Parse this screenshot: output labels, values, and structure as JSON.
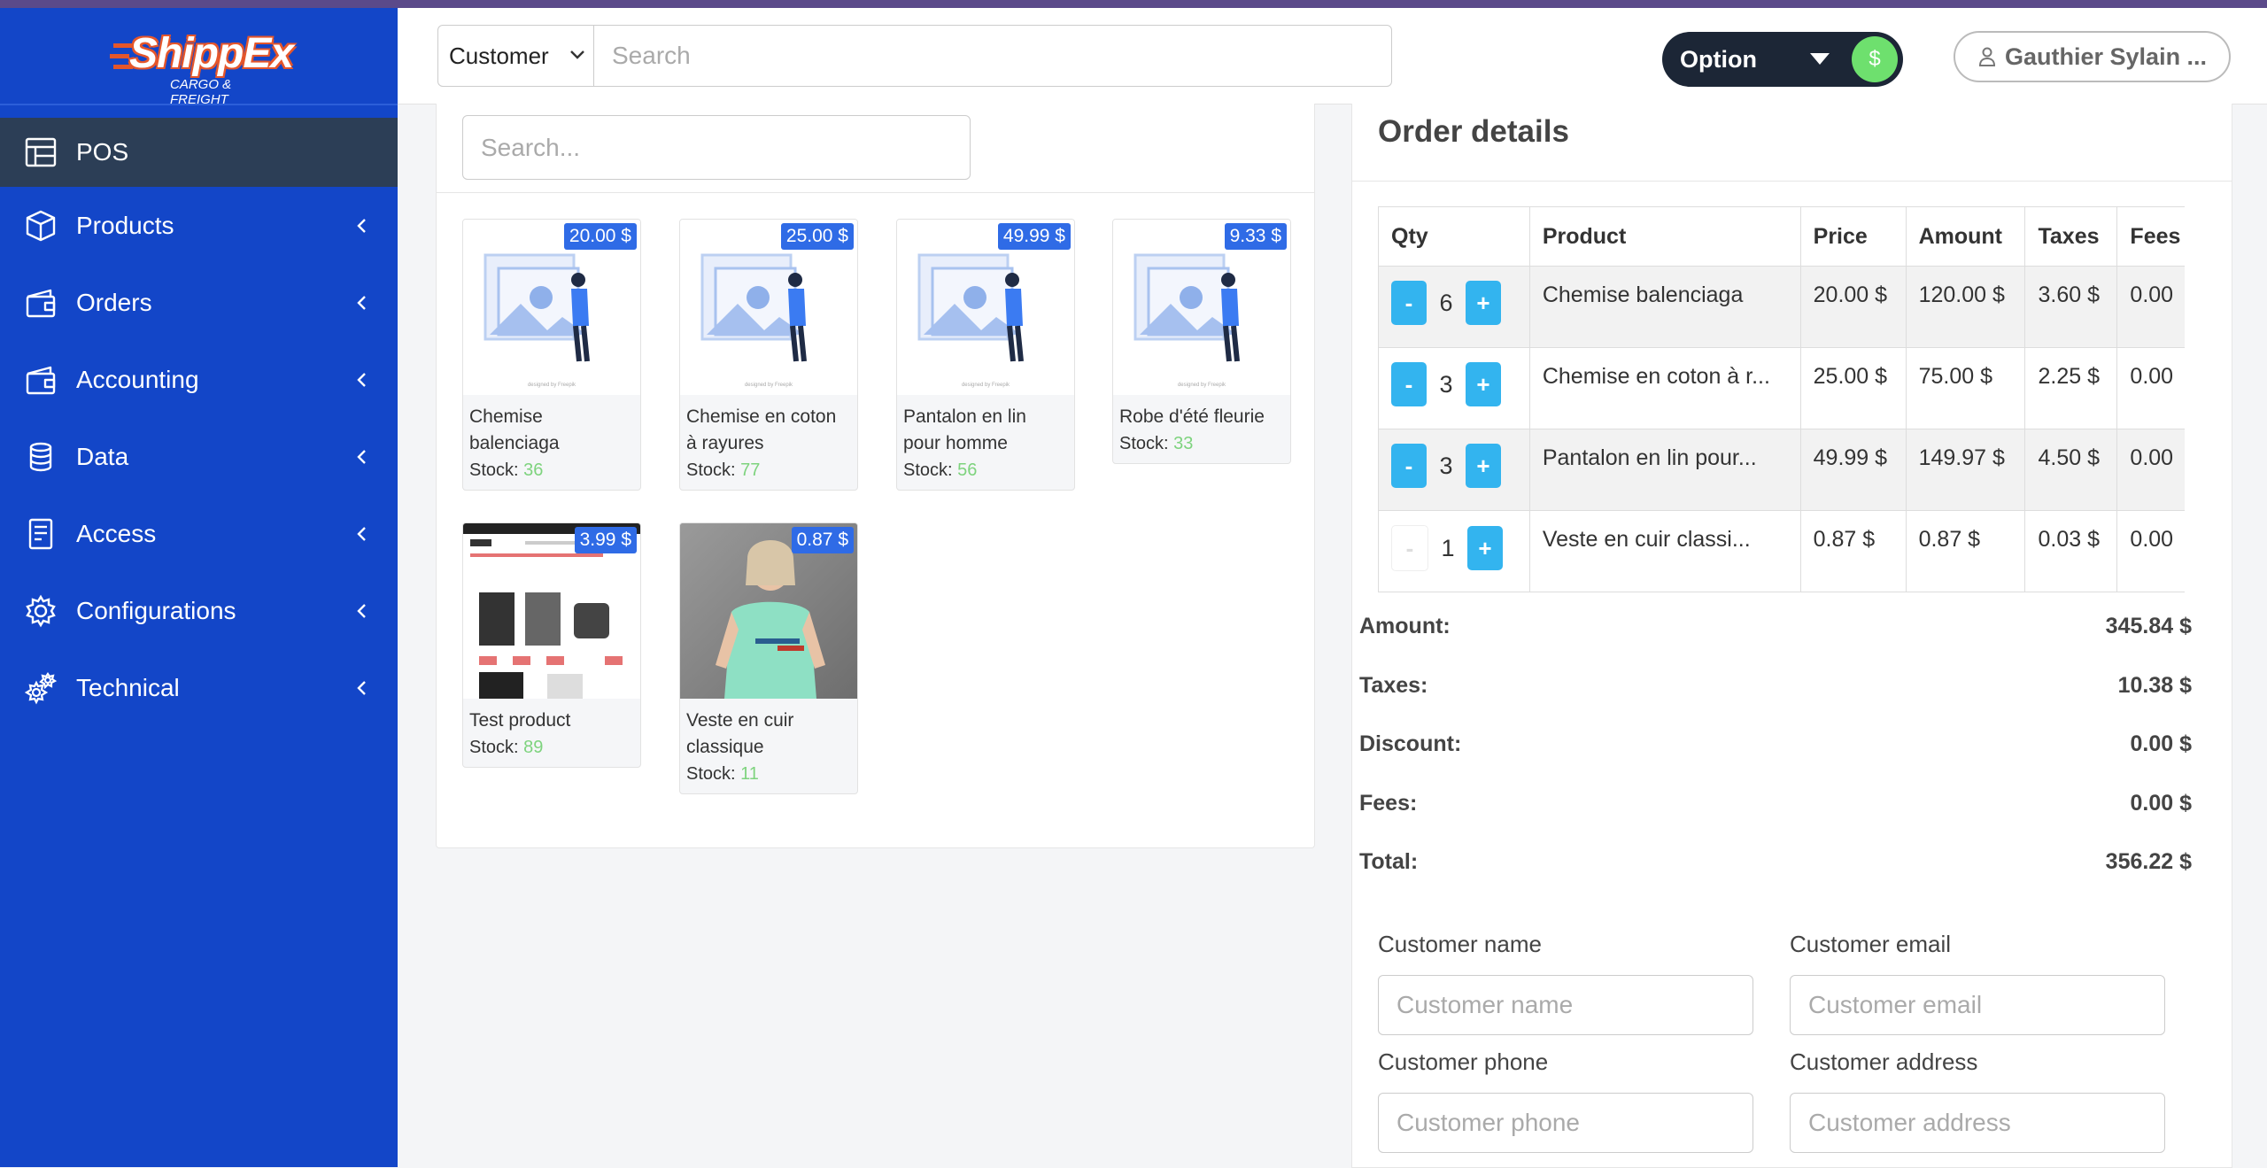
{
  "colors": {
    "sidebar_bg": "#1346c8",
    "sidebar_active": "#2c3e56",
    "price_badge": "#2f6be6",
    "qty_button": "#33b4ef",
    "stock_number": "#7ed37e",
    "option_pill": "#1c2636",
    "currency_toggle": "#6ee06e",
    "logo_accent": "#e5562b"
  },
  "brand": {
    "name": "ShippEx",
    "tagline": "CARGO & FREIGHT"
  },
  "sidebar": {
    "items": [
      {
        "label": "POS",
        "icon": "table-layout-icon",
        "active": true
      },
      {
        "label": "Products",
        "icon": "box-icon"
      },
      {
        "label": "Orders",
        "icon": "wallet-icon"
      },
      {
        "label": "Accounting",
        "icon": "wallet-icon"
      },
      {
        "label": "Data",
        "icon": "database-icon"
      },
      {
        "label": "Access",
        "icon": "access-list-icon"
      },
      {
        "label": "Configurations",
        "icon": "gear-icon"
      },
      {
        "label": "Technical",
        "icon": "gears-icon"
      }
    ]
  },
  "header": {
    "search_type": "Customer",
    "search_placeholder": "Search",
    "option_label": "Option",
    "currency_symbol": "$",
    "user_name": "Gauthier Sylain ..."
  },
  "products": {
    "search_placeholder": "Search...",
    "stock_label": "Stock:",
    "items": [
      {
        "name": "Chemise balenciaga",
        "price": "20.00 $",
        "stock": "36",
        "image": "placeholder-illustration"
      },
      {
        "name": "Chemise en coton à rayures",
        "price": "25.00 $",
        "stock": "77",
        "image": "placeholder-illustration"
      },
      {
        "name": "Pantalon en lin pour homme",
        "price": "49.99 $",
        "stock": "56",
        "image": "placeholder-illustration"
      },
      {
        "name": "Robe d'été fleurie",
        "price": "9.33 $",
        "stock": "33",
        "image": "placeholder-illustration"
      },
      {
        "name": "Test product",
        "price": "3.99 $",
        "stock": "89",
        "image": "webpage-screenshot"
      },
      {
        "name": "Veste en cuir classique",
        "price": "0.87 $",
        "stock": "11",
        "image": "person-photo"
      }
    ]
  },
  "order": {
    "title": "Order details",
    "columns": [
      "Qty",
      "Product",
      "Price",
      "Amount",
      "Taxes",
      "Fees"
    ],
    "rows": [
      {
        "qty": "6",
        "product": "Chemise balenciaga",
        "price": "20.00 $",
        "amount": "120.00 $",
        "taxes": "3.60 $",
        "fees": "0.00",
        "minus_enabled": true
      },
      {
        "qty": "3",
        "product": "Chemise en coton à r...",
        "price": "25.00 $",
        "amount": "75.00 $",
        "taxes": "2.25 $",
        "fees": "0.00",
        "minus_enabled": true
      },
      {
        "qty": "3",
        "product": "Pantalon en lin pour...",
        "price": "49.99 $",
        "amount": "149.97 $",
        "taxes": "4.50 $",
        "fees": "0.00",
        "minus_enabled": true
      },
      {
        "qty": "1",
        "product": "Veste en cuir classi...",
        "price": "0.87 $",
        "amount": "0.87 $",
        "taxes": "0.03 $",
        "fees": "0.00",
        "minus_enabled": false
      }
    ],
    "minus_label": "-",
    "plus_label": "+",
    "totals": [
      {
        "label": "Amount:",
        "value": "345.84 $"
      },
      {
        "label": "Taxes:",
        "value": "10.38 $"
      },
      {
        "label": "Discount:",
        "value": "0.00 $"
      },
      {
        "label": "Fees:",
        "value": "0.00 $"
      },
      {
        "label": "Total:",
        "value": "356.22 $"
      }
    ]
  },
  "customer_form": {
    "name_label": "Customer name",
    "name_placeholder": "Customer name",
    "email_label": "Customer email",
    "email_placeholder": "Customer email",
    "phone_label": "Customer phone",
    "phone_placeholder": "Customer phone",
    "address_label": "Customer address",
    "address_placeholder": "Customer address"
  }
}
